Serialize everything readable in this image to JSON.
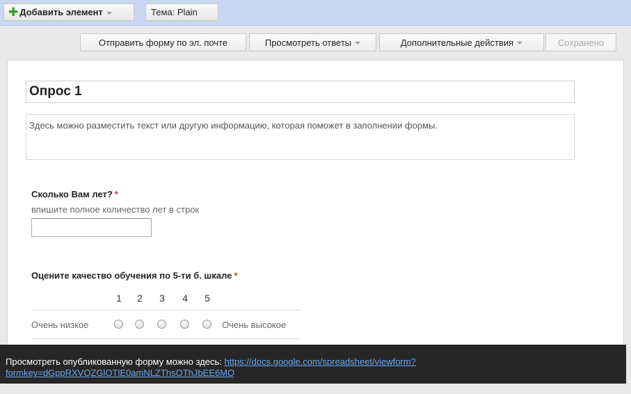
{
  "toolbar": {
    "add_item_label": "Добавить элемент",
    "theme_label": "Тема:",
    "theme_value": "Plain"
  },
  "actions": {
    "email_form": "Отправить форму по эл. почте",
    "view_responses": "Просмотреть ответы",
    "more_actions": "Дополнительные действия",
    "saved": "Сохранено"
  },
  "form": {
    "title": "Опрос 1",
    "description": "Здесь можно разместить текст или другую информацию, которая поможет в заполнении формы.",
    "questions": [
      {
        "title": "Сколько Вам лет?",
        "required_mark": "*",
        "help_text": "впишите полное количество лет в строк",
        "answer_value": ""
      },
      {
        "title": "Оцените качество обучения по 5-ти б. шкале",
        "required_mark": "*",
        "scale": [
          "1",
          "2",
          "3",
          "4",
          "5"
        ],
        "low_label": "Очень низкое",
        "high_label": "Очень высокое",
        "selected": null
      }
    ]
  },
  "infobar": {
    "text": "Просмотреть опубликованную форму можно здесь:",
    "link_line1": "https://docs.google.com/spreadsheet/viewform?",
    "link_line2": "formkey=dGppRXVQZGlOTlE0amNLZThsOThJbEE6MQ"
  },
  "colors": {
    "toolbar_bg": "#c9d7f1",
    "required": "#c43c35",
    "infobar_bg": "#262626",
    "link": "#6fa6ee",
    "add_icon": "#3a9d23"
  },
  "icons": [
    "plus-icon",
    "dropdown-caret-icon"
  ]
}
